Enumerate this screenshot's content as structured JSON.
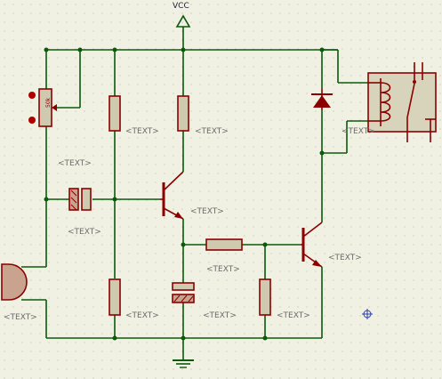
{
  "supply_label": "VCC",
  "pot_value": "50k",
  "component_labels": {
    "r1": "<TEXT>",
    "r2": "<TEXT>",
    "pot": "<TEXT>",
    "c1": "<TEXT>",
    "q1": "<TEXT>",
    "r3": "<TEXT>",
    "mic": "<TEXT>",
    "r4": "<TEXT>",
    "c2": "<TEXT>",
    "r5": "<TEXT>",
    "r6": "<TEXT>",
    "q2": "<TEXT>",
    "relay": "<TEXT>"
  },
  "colors": {
    "background": "#f1f1e3",
    "wire": "#0a5a0a",
    "component": "#8b0000",
    "label": "#6b6b6b"
  }
}
